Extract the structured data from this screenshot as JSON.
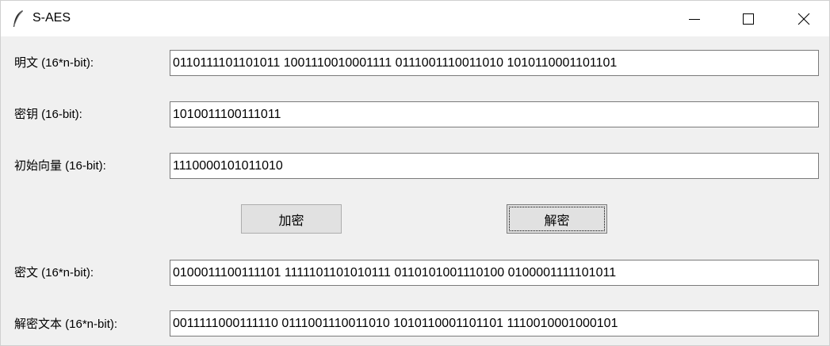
{
  "window": {
    "title": "S-AES",
    "icon": "feather-icon",
    "controls": {
      "minimize": "minimize-icon",
      "maximize": "maximize-icon",
      "close": "close-icon"
    }
  },
  "form": {
    "plaintext": {
      "label": "明文 (16*n-bit):",
      "value": "0110111101101011 1001110010001111 0111001110011010 1010110001101101"
    },
    "key": {
      "label": "密钥 (16-bit):",
      "value": "1010011100111011"
    },
    "iv": {
      "label": "初始向量 (16-bit):",
      "value": "1110000101011010"
    },
    "ciphertext": {
      "label": "密文 (16*n-bit):",
      "value": "0100011100111101 1111101101010111 0110101001110100 0100001111101011"
    },
    "decrypted": {
      "label": "解密文本 (16*n-bit):",
      "value": "0011111000111110 0111001110011010 1010110001101101 1110010001000101"
    }
  },
  "buttons": {
    "encrypt": "加密",
    "decrypt": "解密"
  }
}
